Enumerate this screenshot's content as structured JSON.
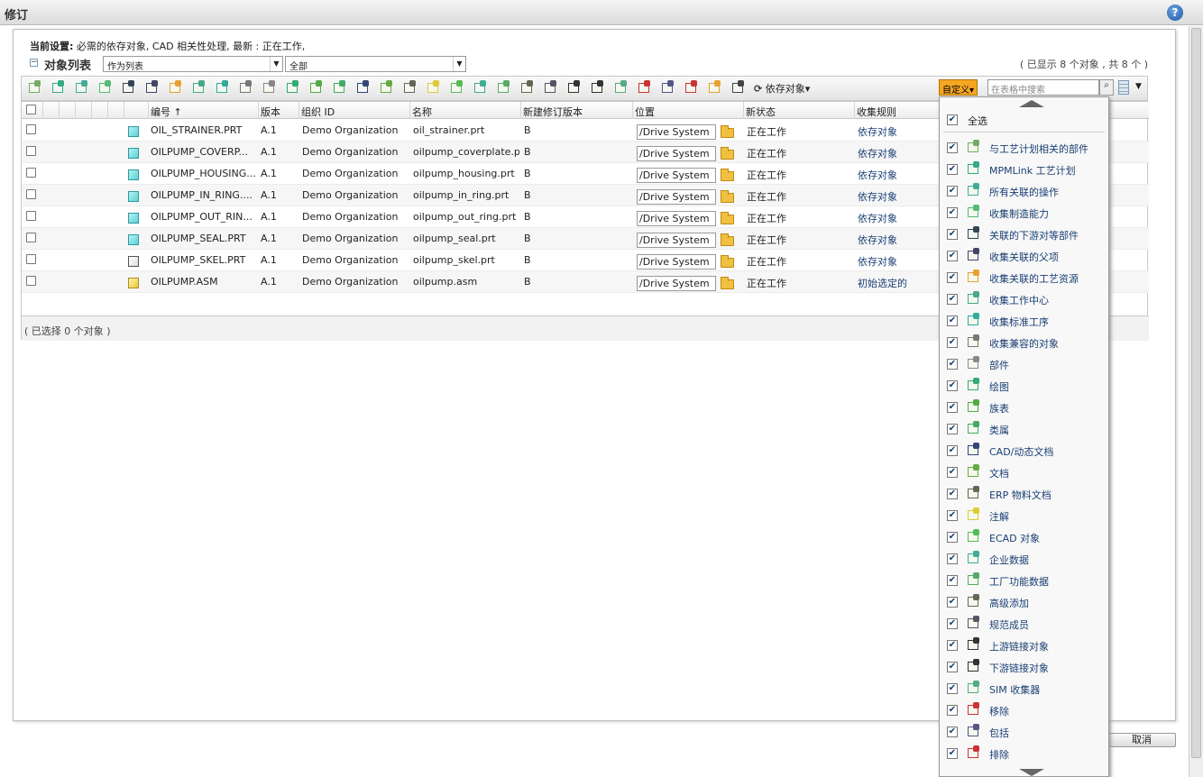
{
  "window": {
    "title": "修订",
    "help_label": "?"
  },
  "settings": {
    "prefix": "当前设置:",
    "text": "必需的依存对象, CAD 相关性处理, 最新 : 正在工作,"
  },
  "object_list": {
    "toggle": "⊟",
    "title": "对象列表",
    "view_select": "作为列表",
    "filter_select": "全部",
    "count_text": "( 已显示 8 个对象 , 共 8 个 )"
  },
  "toolbar": {
    "dependents_label": "依存对象",
    "customize_label": "自定义",
    "search_placeholder": "在表格中搜索"
  },
  "table": {
    "columns": [
      "编号",
      "版本",
      "组织 ID",
      "名称",
      "新建修订版本",
      "位置",
      "新状态",
      "收集规则"
    ],
    "sort_indicator": "↑",
    "rows": [
      {
        "number": "OIL_STRAINER.PRT",
        "version": "A.1",
        "org": "Demo Organization",
        "name": "oil_strainer.prt",
        "revision": "B",
        "location": "/Drive System",
        "state": "正在工作",
        "rule": "依存对象",
        "icon": "part-icon"
      },
      {
        "number": "OILPUMP_COVERP...",
        "version": "A.1",
        "org": "Demo Organization",
        "name": "oilpump_coverplate.prt",
        "revision": "B",
        "location": "/Drive System",
        "state": "正在工作",
        "rule": "依存对象",
        "icon": "part-icon"
      },
      {
        "number": "OILPUMP_HOUSING...",
        "version": "A.1",
        "org": "Demo Organization",
        "name": "oilpump_housing.prt",
        "revision": "B",
        "location": "/Drive System",
        "state": "正在工作",
        "rule": "依存对象",
        "icon": "part-icon"
      },
      {
        "number": "OILPUMP_IN_RING....",
        "version": "A.1",
        "org": "Demo Organization",
        "name": "oilpump_in_ring.prt",
        "revision": "B",
        "location": "/Drive System",
        "state": "正在工作",
        "rule": "依存对象",
        "icon": "part-icon"
      },
      {
        "number": "OILPUMP_OUT_RIN...",
        "version": "A.1",
        "org": "Demo Organization",
        "name": "oilpump_out_ring.prt",
        "revision": "B",
        "location": "/Drive System",
        "state": "正在工作",
        "rule": "依存对象",
        "icon": "part-icon"
      },
      {
        "number": "OILPUMP_SEAL.PRT",
        "version": "A.1",
        "org": "Demo Organization",
        "name": "oilpump_seal.prt",
        "revision": "B",
        "location": "/Drive System",
        "state": "正在工作",
        "rule": "依存对象",
        "icon": "part-icon"
      },
      {
        "number": "OILPUMP_SKEL.PRT",
        "version": "A.1",
        "org": "Demo Organization",
        "name": "oilpump_skel.prt",
        "revision": "B",
        "location": "/Drive System",
        "state": "正在工作",
        "rule": "依存对象",
        "icon": "skeleton-icon"
      },
      {
        "number": "OILPUMP.ASM",
        "version": "A.1",
        "org": "Demo Organization",
        "name": "oilpump.asm",
        "revision": "B",
        "location": "/Drive System",
        "state": "正在工作",
        "rule": "初始选定的",
        "icon": "assembly-icon"
      }
    ],
    "selected_text": "( 已选择 0 个对象 )"
  },
  "dropdown": {
    "select_all": "全选",
    "items": [
      "与工艺计划相关的部件",
      "MPMLink 工艺计划",
      "所有关联的操作",
      "收集制造能力",
      "关联的下游对等部件",
      "收集关联的父项",
      "收集关联的工艺资源",
      "收集工作中心",
      "收集标准工序",
      "收集兼容的对象",
      "部件",
      "绘图",
      "族表",
      "类属",
      "CAD/动态文档",
      "文档",
      "ERP 物料文档",
      "注解",
      "ECAD 对象",
      "企业数据",
      "工厂功能数据",
      "高级添加",
      "规范成员",
      "上游链接对象",
      "下游链接对象",
      "SIM 收集器",
      "移除",
      "包括",
      "排除"
    ]
  },
  "buttons": {
    "cancel": "取消"
  },
  "colors": {
    "accent": "#f5a623",
    "link": "#1a3f73"
  }
}
